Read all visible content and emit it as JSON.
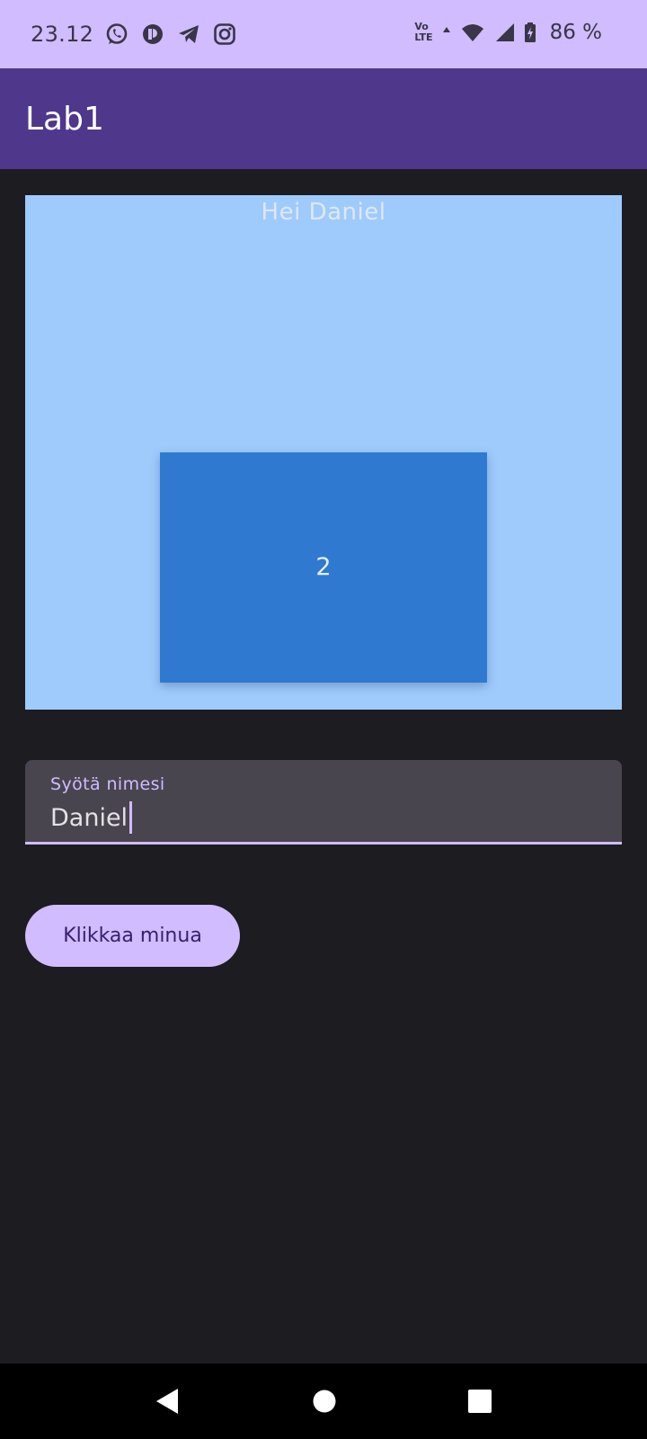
{
  "status_bar": {
    "time": "23.12",
    "notification_icons": [
      "whatsapp-icon",
      "app-icon",
      "telegram-icon",
      "instagram-icon"
    ],
    "volte_line1": "Vo",
    "volte_line2": "LTE",
    "battery_percent": "86 %",
    "background": "#d0bcfe"
  },
  "app_bar": {
    "title": "Lab1",
    "background": "#4f378b"
  },
  "content": {
    "greeting": "Hei Daniel",
    "counter": "2",
    "outer_box_color": "#9ecbfc",
    "inner_box_color": "#2f7ad0"
  },
  "name_field": {
    "label": "Syötä nimesi",
    "value": "Daniel"
  },
  "button": {
    "label": "Klikkaa minua",
    "color": "#d0bcfe"
  },
  "nav_bar": {
    "icons": [
      "back-icon",
      "home-icon",
      "recents-icon"
    ]
  }
}
